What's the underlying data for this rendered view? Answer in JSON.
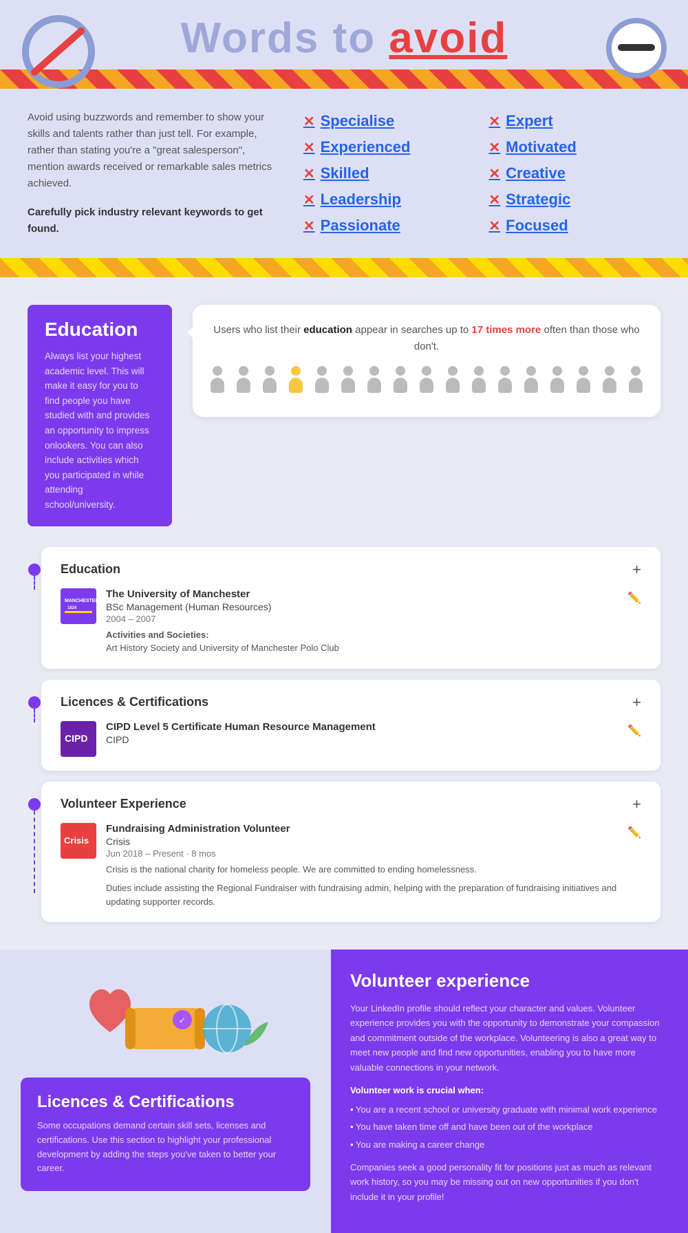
{
  "header": {
    "title_plain": "Words to ",
    "title_highlight": "avoid"
  },
  "intro_text": "Avoid using buzzwords and remember to show your skills and talents rather than just tell. For example, rather than stating you're a \"great salesperson\", mention awards received or remarkable sales metrics achieved.",
  "keyword_advice": "Carefully pick industry relevant keywords to get found.",
  "words_left": [
    "Specialise",
    "Experienced",
    "Skilled",
    "Leadership",
    "Passionate"
  ],
  "words_right": [
    "Expert",
    "Motivated",
    "Creative",
    "Strategic",
    "Focused"
  ],
  "education_section": {
    "title": "Education",
    "description": "Always list your highest academic level. This will make it easy for you to find people you have studied with and provides an opportunity to impress onlookers. You can also include activities which you participated in while attending school/university.",
    "bubble_text1": "Users who list their ",
    "bubble_bold": "education",
    "bubble_text2": " appear in searches up to ",
    "bubble_highlight": "17 times more",
    "bubble_text3": " often than those who don't."
  },
  "cards": {
    "education": {
      "section_title": "Education",
      "add_label": "+",
      "entry": {
        "institution": "The University of Manchester",
        "degree": "BSc Management (Human Resources)",
        "dates": "2004 – 2007",
        "activities_label": "Activities and Societies:",
        "activities": "Art History Society and University of Manchester Polo Club"
      }
    },
    "licences": {
      "section_title": "Licences & Certifications",
      "add_label": "+",
      "entry": {
        "cert_name": "CIPD Level 5 Certificate Human Resource Management",
        "org": "CIPD"
      }
    },
    "volunteer": {
      "section_title": "Volunteer Experience",
      "add_label": "+",
      "entry": {
        "role": "Fundraising Administration Volunteer",
        "org": "Crisis",
        "dates": "Jun 2018 – Present · 8 mos",
        "desc1": "Crisis is the national charity for homeless people. We are committed to ending homelessness.",
        "desc2": "Duties include assisting the Regional Fundraiser with fundraising admin, helping with the preparation of fundraising initiatives and updating supporter records."
      }
    }
  },
  "bottom": {
    "licences_title": "Licences & Certifications",
    "licences_desc": "Some occupations demand certain skill sets, licenses and certifications. Use this section to highlight your professional development by adding the steps you've taken to better your career.",
    "volunteer_title": "Volunteer experience",
    "volunteer_desc": "Your LinkedIn profile should reflect your character and values. Volunteer experience provides you with the opportunity to demonstrate your compassion and commitment outside of the workplace. Volunteering is also a great way to meet new people and find new opportunities, enabling you to have more valuable connections in your network.",
    "volunteer_when_label": "Volunteer work is crucial when:",
    "volunteer_bullets": [
      "You are a recent school or university graduate with minimal work experience",
      "You have taken time off and have been out of the workplace",
      "You are making a career change"
    ],
    "volunteer_closing": "Companies seek a good personality fit for positions just as much as relevant work history, so you may be missing out on new opportunities if you don't include it in your profile!"
  }
}
